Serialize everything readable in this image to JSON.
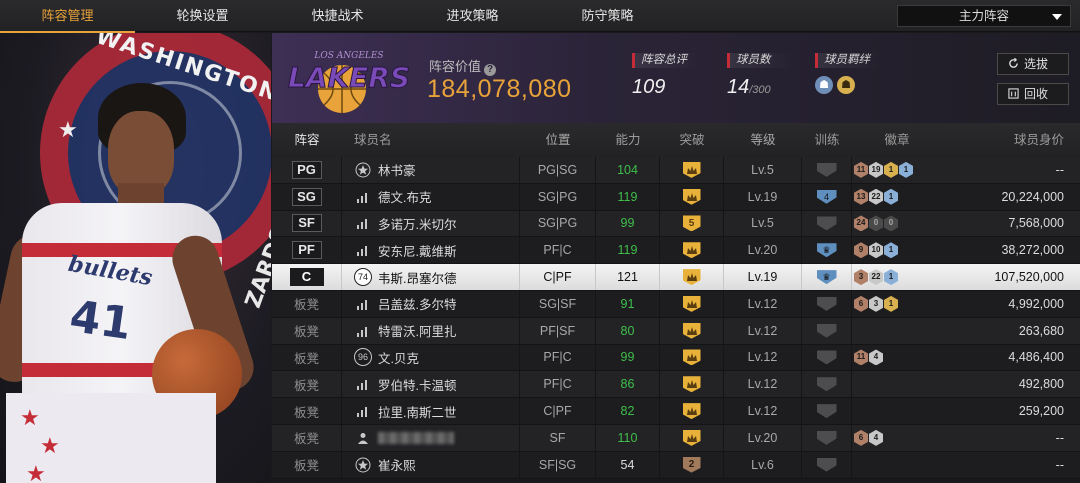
{
  "nav": {
    "tabs": [
      {
        "label": "阵容管理",
        "active": true
      },
      {
        "label": "轮换设置",
        "active": false
      },
      {
        "label": "快捷战术",
        "active": false
      },
      {
        "label": "进攻策略",
        "active": false
      },
      {
        "label": "防守策略",
        "active": false
      }
    ],
    "lineup_select": "主力阵容"
  },
  "player_art": {
    "team_text": "WASHINGTON",
    "jersey_text": "bullets",
    "jersey_number": "41",
    "shorts_text": "ZARDS"
  },
  "team": {
    "logo_text": "LAKERS",
    "logo_subtext": "LOS ANGELES",
    "value_label": "阵容价值",
    "value": "184,078,080",
    "rating_label": "阵容总评",
    "rating": "109",
    "count_label": "球员数",
    "count": "14",
    "count_max": "/300",
    "bond_label": "球员羁绊",
    "select_button": "选拔",
    "recycle_button": "回收"
  },
  "table": {
    "headers": [
      "阵容",
      "球员名",
      "位置",
      "能力",
      "突破",
      "等级",
      "训练",
      "徽章",
      "球员身价"
    ],
    "rows": [
      {
        "pos": "PG",
        "starter": true,
        "icon": "star",
        "name": "林书豪",
        "role": "PG|SG",
        "ability": "104",
        "green": true,
        "break": "",
        "level": "Lv.5",
        "train": "",
        "badges": [
          [
            "b-br",
            "11"
          ],
          [
            "b-si",
            "19"
          ],
          [
            "b-go",
            "1"
          ],
          [
            "b-pl",
            "1"
          ]
        ],
        "price": "--"
      },
      {
        "pos": "SG",
        "starter": true,
        "icon": "bars",
        "name": "德文.布克",
        "role": "SG|PG",
        "ability": "119",
        "green": true,
        "break": "",
        "level": "Lv.19",
        "train": "4",
        "badges": [
          [
            "b-br",
            "13"
          ],
          [
            "b-si",
            "22"
          ],
          [
            "b-pl",
            "1"
          ]
        ],
        "price": "20,224,000"
      },
      {
        "pos": "SF",
        "starter": true,
        "icon": "bars",
        "name": "多诺万.米切尔",
        "role": "SG|PG",
        "ability": "99",
        "green": true,
        "break": "5",
        "level": "Lv.5",
        "train": "",
        "badges": [
          [
            "b-br",
            "24"
          ],
          [
            "b-dk",
            "0"
          ],
          [
            "b-dk",
            "0"
          ]
        ],
        "price": "7,568,000"
      },
      {
        "pos": "PF",
        "starter": true,
        "icon": "bars",
        "name": "安东尼.戴维斯",
        "role": "PF|C",
        "ability": "119",
        "green": true,
        "break": "",
        "level": "Lv.20",
        "train": "blue",
        "badges": [
          [
            "b-br",
            "9"
          ],
          [
            "b-si",
            "10"
          ],
          [
            "b-pl",
            "1"
          ]
        ],
        "price": "38,272,000"
      },
      {
        "pos": "C",
        "starter": true,
        "selected": true,
        "icon": "74",
        "name": "韦斯.昂塞尔德",
        "role": "C|PF",
        "ability": "121",
        "green": false,
        "break": "",
        "level": "Lv.19",
        "train": "blue",
        "badges": [
          [
            "b-br",
            "3"
          ],
          [
            "b-si",
            "22"
          ],
          [
            "b-pl",
            "1"
          ]
        ],
        "price": "107,520,000"
      },
      {
        "pos": "板凳",
        "starter": false,
        "icon": "bars",
        "name": "吕盖兹.多尔特",
        "role": "SG|SF",
        "ability": "91",
        "green": true,
        "break": "",
        "level": "Lv.12",
        "train": "",
        "badges": [
          [
            "b-br",
            "6"
          ],
          [
            "b-si",
            "3"
          ],
          [
            "b-go",
            "1"
          ]
        ],
        "price": "4,992,000"
      },
      {
        "pos": "板凳",
        "starter": false,
        "icon": "bars",
        "name": "特雷沃.阿里扎",
        "role": "PF|SF",
        "ability": "80",
        "green": true,
        "break": "",
        "level": "Lv.12",
        "train": "",
        "badges": [],
        "price": "263,680"
      },
      {
        "pos": "板凳",
        "starter": false,
        "icon": "96",
        "name": "文.贝克",
        "role": "PF|C",
        "ability": "99",
        "green": true,
        "break": "",
        "level": "Lv.12",
        "train": "",
        "badges": [
          [
            "b-br",
            "11"
          ],
          [
            "b-si",
            "4"
          ]
        ],
        "price": "4,486,400"
      },
      {
        "pos": "板凳",
        "starter": false,
        "icon": "bars",
        "name": "罗伯特.卡温顿",
        "role": "PF|C",
        "ability": "86",
        "green": true,
        "break": "",
        "level": "Lv.12",
        "train": "",
        "badges": [],
        "price": "492,800"
      },
      {
        "pos": "板凳",
        "starter": false,
        "icon": "bars",
        "name": "拉里.南斯二世",
        "role": "C|PF",
        "ability": "82",
        "green": true,
        "break": "",
        "level": "Lv.12",
        "train": "",
        "badges": [],
        "price": "259,200"
      },
      {
        "pos": "板凳",
        "starter": false,
        "icon": "person",
        "name": "",
        "blurred": true,
        "role": "SF",
        "ability": "110",
        "green": true,
        "break": "",
        "level": "Lv.20",
        "train": "",
        "badges": [
          [
            "b-br",
            "6"
          ],
          [
            "b-si",
            "4"
          ]
        ],
        "price": "--"
      },
      {
        "pos": "板凳",
        "starter": false,
        "icon": "star",
        "name": "崔永熙",
        "role": "SF|SG",
        "ability": "54",
        "green": false,
        "break": "2",
        "breakDark": true,
        "level": "Lv.6",
        "train": "",
        "badges": [],
        "price": "--"
      }
    ]
  },
  "colors": {
    "accent": "#e8a33a",
    "green": "#3fbf4a",
    "red": "#c42c38"
  }
}
